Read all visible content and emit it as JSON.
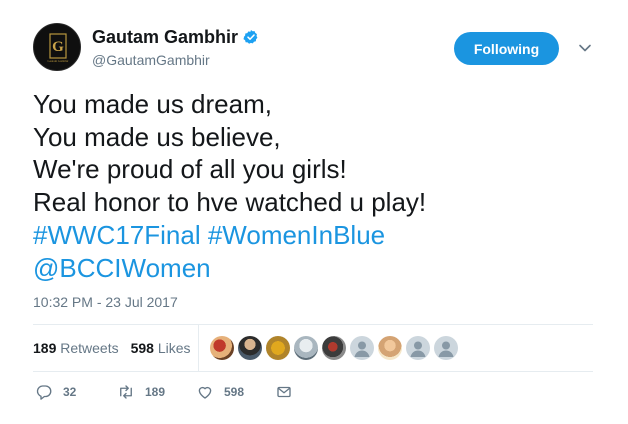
{
  "user": {
    "display_name": "Gautam Gambhir",
    "handle": "@GautamGambhir",
    "avatar_letter": "G",
    "avatar_subtext": "Gautam Gambhir",
    "verified": true
  },
  "header": {
    "follow_label": "Following"
  },
  "tweet": {
    "lines": [
      "You made us dream,",
      "You made us believe,",
      "We're proud of all you girls!",
      "Real honor to hve watched u play!"
    ],
    "hashtag_1": "#WWC17Final",
    "hashtag_2": "#WomenInBlue",
    "mention": "@BCCIWomen",
    "timestamp": "10:32 PM - 23 Jul 2017"
  },
  "stats": {
    "retweets_count": "189",
    "retweets_label": "Retweets",
    "likes_count": "598",
    "likes_label": "Likes"
  },
  "actions": {
    "reply_count": "32",
    "retweet_count": "189",
    "like_count": "598"
  },
  "colors": {
    "accent": "#1b95e0",
    "muted": "#657786",
    "text": "#14171a",
    "border": "#e6ecf0"
  },
  "icons": [
    "verified-badge-icon",
    "chevron-down-icon",
    "reply-icon",
    "retweet-icon",
    "heart-icon",
    "mail-icon"
  ]
}
